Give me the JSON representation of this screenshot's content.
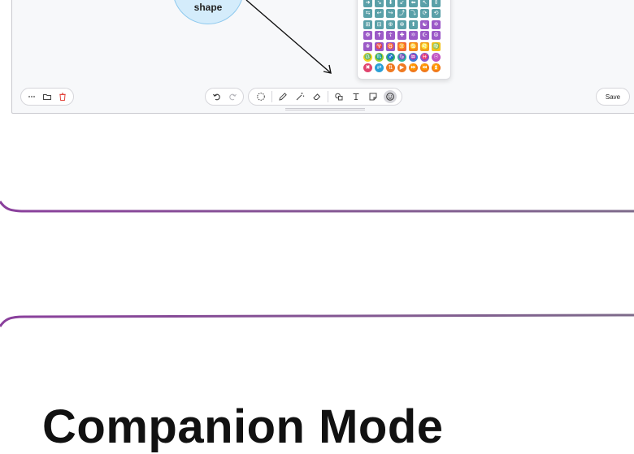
{
  "canvas": {
    "shape_label": "shape"
  },
  "emoji_panel": {
    "rows": [
      [
        "#5aa0a8",
        "#5aa0a8",
        "#5aa0a8",
        "#5aa0a8",
        "#5aa0a8",
        "#5aa0a8",
        "#5aa0a8"
      ],
      [
        "#5aa0a8",
        "#5aa0a8",
        "#5aa0a8",
        "#5aa0a8",
        "#5aa0a8",
        "#5aa0a8",
        "#5aa0a8"
      ],
      [
        "#5aa0a8",
        "#5aa0a8",
        "#5aa0a8",
        "#5aa0a8",
        "#5aa0a8",
        "#9b59c7",
        "#9b59c7"
      ],
      [
        "#9b59c7",
        "#9b59c7",
        "#9b59c7",
        "#9b59c7",
        "#9b59c7",
        "#9b59c7",
        "#9b59c7"
      ],
      [
        "#9b59c7",
        "#9b59c7",
        "#9b59c7",
        "#f06a3a",
        "#f28a1f",
        "#f2a21e",
        "#f2c31e"
      ],
      [
        "#f2d21e",
        "#a0cf2e",
        "#40b46a",
        "#2bb4a0",
        "#3b7dd8",
        "#8a5ad2",
        "#c154c1"
      ],
      [
        "#e0446e",
        "#2a9fd6",
        "#ef7a22",
        "#ef7a22",
        "#ef7a22",
        "#ef7a22",
        "#ef7a22"
      ]
    ]
  },
  "toolbar": {
    "left_group": [
      "more-icon",
      "folder-icon",
      "trash-icon"
    ],
    "history_group": [
      "undo-icon",
      "redo-icon"
    ],
    "tools_group": [
      "lasso-icon",
      "pen-icon",
      "magic-wand-icon",
      "eraser-icon",
      "shapes-icon",
      "text-icon",
      "sticky-note-icon",
      "emoji-icon"
    ],
    "save_label": "Save"
  },
  "heading": {
    "text": "Companion Mode"
  }
}
